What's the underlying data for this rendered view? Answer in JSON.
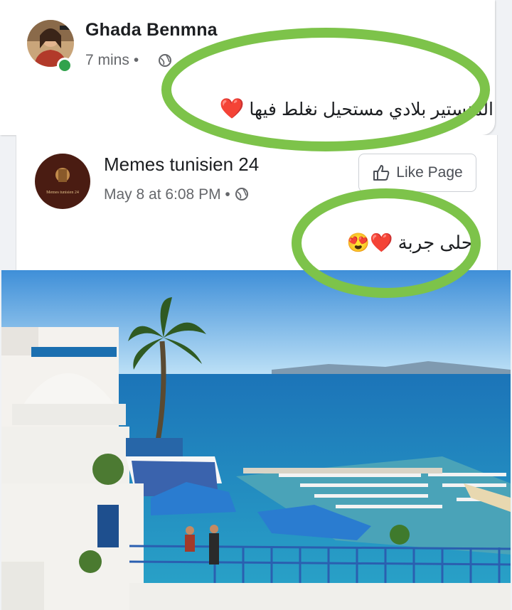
{
  "post": {
    "author": "Ghada Benmna",
    "time": "7 mins",
    "text": "المنستير  بلادي مستحيل نغلط فيها",
    "emoji": "❤️"
  },
  "shared_post": {
    "page_name": "Memes tunisien 24",
    "avatar_caption": "Memes tunisien 24",
    "date": "May 8 at 6:08 PM",
    "like_button": "Like Page",
    "text": "أحلى جربة",
    "emojis": "❤️😍"
  },
  "colors": {
    "highlight_ring": "#7dc34a",
    "facebook_text": "#1c1e21",
    "meta_gray": "#65676b",
    "online": "#31a24c"
  },
  "icons": [
    "globe-icon",
    "like-thumb-icon",
    "heart-emoji",
    "heart-eyes-emoji"
  ]
}
